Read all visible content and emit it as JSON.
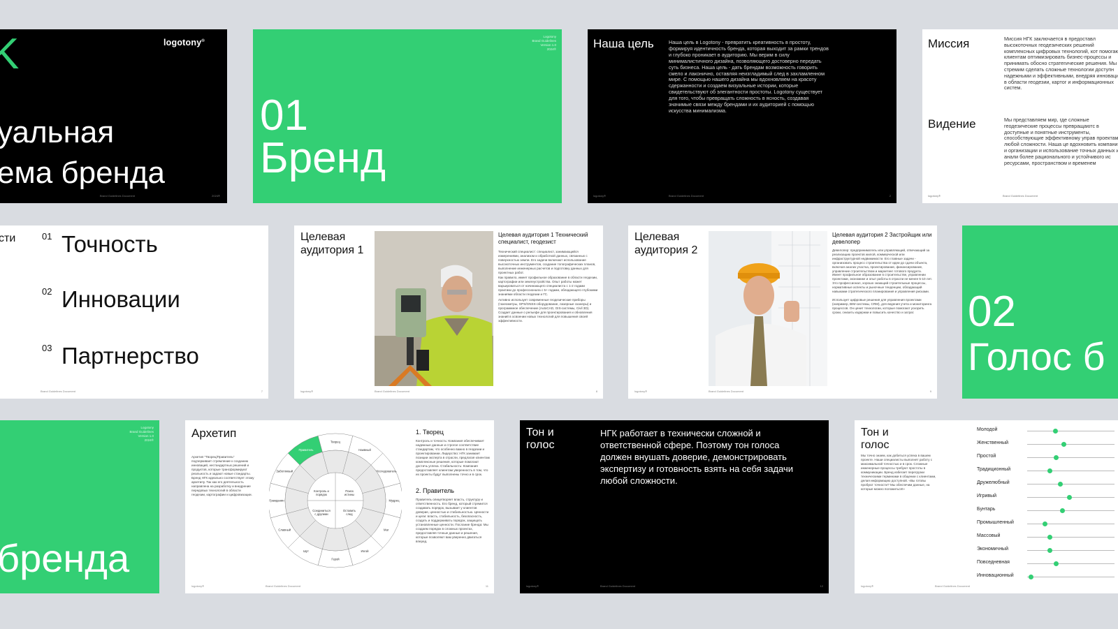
{
  "s1": {
    "logo": "logotony",
    "logo_mark": "®",
    "k_glyph": "K",
    "line1": "уальная",
    "line2": "ема бренда",
    "footer_doc": "Brand Guidelines Document",
    "footer_year": "2024®"
  },
  "s2": {
    "meta": [
      "Logotony",
      "Brand Guidelines",
      "Version 1.0",
      "2024®"
    ],
    "number": "01",
    "title": "Бренд"
  },
  "s3": {
    "title": "Наша цель",
    "body": "Наша цель в Logotony - превратить креативность в простоту, формируя идентичность бренда, которая выходит за рамки трендов и глубоко проникает в аудиторию. Мы верим в силу минималистичного дизайна, позволяющего достоверно передать суть бизнеса. Наша цель - дать брендам возможность говорить смело и лаконично, оставляя неизгладимый след в захламленном мире. С помощью нашего дизайна мы вдохновляем на красоту сдержанности и создаем визуальные истории, которые свидетельствуют об элегантности простоты. Logotony существует для того, чтобы превращать сложность в ясность, создавая значимые связи между брендами и их аудиторией с помощью искусства минимализма.",
    "footer_logo": "logotony®",
    "footer_doc": "Brand Guidelines Document",
    "page": "2"
  },
  "s4": {
    "mission_title": "Миссия",
    "mission_body": "Миссия НГК заключается в предоставл высокоточных геодезических решений комплексных цифровых технологий, кот помогают клиентам оптимизировать бизнес-процессы и принимать обосно стратегические решения. Мы стремим сделать сложные технологии доступн надежными и эффективными, внедряя инновации в области геодезии, картог и информационных систем.",
    "vision_title": "Видение",
    "vision_body": "Мы представляем мир, где сложные геодезические процессы превращаютс в доступные и понятные инструменты, способствующие эффективному управ проектами любой сложности. Наша це вдохновить компании и организации и использование точных данных и анали более рационального и устойчивого ис ресурсами, пространством и временем",
    "footer_logo": "logotony®",
    "footer_doc": "Brand Guidelines Document"
  },
  "s5": {
    "label": "сти",
    "items": [
      {
        "num": "01",
        "text": "Точность"
      },
      {
        "num": "02",
        "text": "Инновации"
      },
      {
        "num": "03",
        "text": "Партнерство"
      }
    ],
    "footer_doc": "Brand Guidelines Document",
    "page": "7"
  },
  "s6": {
    "title": "Целевая аудитория 1",
    "subtitle": "Целевая аудитория 1 Технический специалист, геодезист",
    "p1": "Технический специалист: специалист, занимающийся измерениями, анализом и обработкой данных, связанных с поверхностью земли. Его задачи включают использование высокоточных инструментов, создание топографических планов, выполнение инженерных расчетов и подготовку данных для проектных работ.",
    "p2": "Как правило, имеет профильное образование в области геодезии, картографии или землеустройства. Опыт работы может варьироваться от начинающего специалиста с 1-2 годами практики до профессионала с 5+ годами, обладающего глубокими знаниями области геодезии и ГС.",
    "p3": "Активно использует современные геодезические приборы (тахеометры, GPS/GNSS-оборудование, лазерные сканеры) и программное обеспечение (AutoCAD, GIS-системы, Civil 3D). Создает данные о рельефе для проектирования и обновления знаний в освоении новых технологий для повышения своей эффективности.",
    "footer_logo": "logotony®",
    "footer_doc": "Brand Guidelines Document",
    "page": "8"
  },
  "s7": {
    "title": "Целевая аудитория 2",
    "subtitle": "Целевая аудитория 2 Застройщик или девелопер",
    "p1": "Девелопер: предприниматель или управляющий, отвечающий за реализацию проектов жилой, коммерческой или инфраструктурной недвижимости. Его главные задачи - организовать процесс строительства от идеи до сдачи объекта, включая анализ участка, проектирование, финансирование, управление строительством и маркетинг готового продукта.",
    "p2": "Имеет профильное образование в строительстве, управлении проектами, экономике и опыт работы в отрасли не менее 5-10 лет. Это профессионал, хорошо знающий строительные процессы, нормативные аспекты и рыночные тенденции, обладающий навыками стратегического планирования и управления рисками.",
    "p3": "Использует цифровые решения для управления проектами (например, BIM-системы, CRM), для ведения учета и мониторинга процессов. Он ценит технологии, которые помогают ускорить сроки, снизить издержки и повысить качество и затрат.",
    "footer_logo": "logotony®",
    "footer_doc": "Brand Guidelines Document",
    "page": "9"
  },
  "s8": {
    "number": "02",
    "title": "Голос б"
  },
  "s9": {
    "meta": [
      "Logotony",
      "Brand Guidelines",
      "Version 1.0",
      "2024®"
    ],
    "title": "бренда"
  },
  "s10": {
    "title": "Архетип",
    "intro": "Архетип \"Творец/Правитель\" подчеркивает стремление к созданию инноваций, нестандартных решений и продуктов, которые трансформируют реальность и задают новые стандарты. Бренд НГК идеально соответствует этому архетипу. Так как его деятельность направлена на разработку и внедрение передовых технологий в области геодезии, картографии и цифровизации.",
    "wheel_outer": [
      "Творец",
      "Наивный",
      "Исследователь",
      "Мудрец",
      "Маг",
      "Изгой",
      "Простак",
      "Шут",
      "Славный малый",
      "Заботливый",
      "Правитель"
    ],
    "wheel_labels": [
      "Правитель",
      "Творец",
      "Наивный",
      "Исследователь",
      "Мудрец",
      "Маг",
      "Изгой",
      "Герой",
      "Шут",
      "Славный",
      "Гражданин",
      "Заботливый",
      "Любовник",
      "Мужество",
      "Страсть",
      "Сила",
      "Свобода",
      "Сообщество",
      "Инновация",
      "Автономия",
      "Чистота",
      "Любопытство",
      "Игривость",
      "Самообладание",
      "Соединиться с другими",
      "Оставить след",
      "Контроль и порядок",
      "Поиск истины"
    ],
    "c1_title": "1. Творец",
    "c1_body": "Контроль и точность: Компания обеспечивает надежные данные и строгое соответствие стандартам, что особенно важно в геодезии и проектировании. Лидерство: НГК занимает позиции эксперта в отрасли, предлагая клиентам комплексные решения, которые помогают достичь успеха. Стабильность: Компания предоставляет клиентам уверенность в том, что их проекты будут выполнены точно и в срок.",
    "c2_title": "2. Правитель",
    "c2_body": "Правитель олицетворяет власть, структуру и ответственность. Его бренд, который стремится создавать порядок, вызывает у клиентов доверие, ценностью и стабильностью. Ценности и цели: власть, стабильность, безопасность, создать и поддерживать порядок, защищать установленные ценности. Послание бренда: Мы создаем порядок в сложных проектах, предоставляя точные данные и решения, которые позволяют вам уверенно двигаться вперед.",
    "footer_logo": "logotony®",
    "footer_doc": "Brand Guidelines Document",
    "page": "11"
  },
  "s11": {
    "title": "Тон и голос",
    "body": "НГК работает в технически сложной и ответственной сфере. Поэтому тон голоса должен внушать доверие, демонстрировать экспертизу и готовность взять на себя задачи любой сложности.",
    "footer_logo": "logotony®",
    "footer_doc": "Brand Guidelines Document",
    "page": "12"
  },
  "s12": {
    "title": "Тон и голос",
    "body": "Мы точно знаем, как добиться успеха в вашем проекте. Наши специалисты выполнят работу с максимальной точностью и в срок. Сложные инженерные процессы требуют простоты в коммуникации. Бренд избегает перегрузки техническими терминами в общении с клиентами, делая информацию доступной. «Вы готовы пробуют точности? Мы обеспечим данные, на которые можно положиться!»",
    "traits": [
      {
        "label": "Молодой",
        "value": 0.32
      },
      {
        "label": "Женственный",
        "value": 0.42
      },
      {
        "label": "Простой",
        "value": 0.33
      },
      {
        "label": "Традиционный",
        "value": 0.26
      },
      {
        "label": "Дружелюбный",
        "value": 0.38
      },
      {
        "label": "Игривый",
        "value": 0.48
      },
      {
        "label": "Бунтарь",
        "value": 0.4
      },
      {
        "label": "Промышленный",
        "value": 0.2
      },
      {
        "label": "Массовый",
        "value": 0.26
      },
      {
        "label": "Экономичный",
        "value": 0.26
      },
      {
        "label": "Повседневная",
        "value": 0.33
      },
      {
        "label": "Инновационный",
        "value": 0.04
      }
    ],
    "footer_logo": "logotony®",
    "footer_doc": "Brand Guidelines Document"
  },
  "colors": {
    "green": "#33cf74",
    "black": "#000000",
    "background": "#d9dce1"
  }
}
